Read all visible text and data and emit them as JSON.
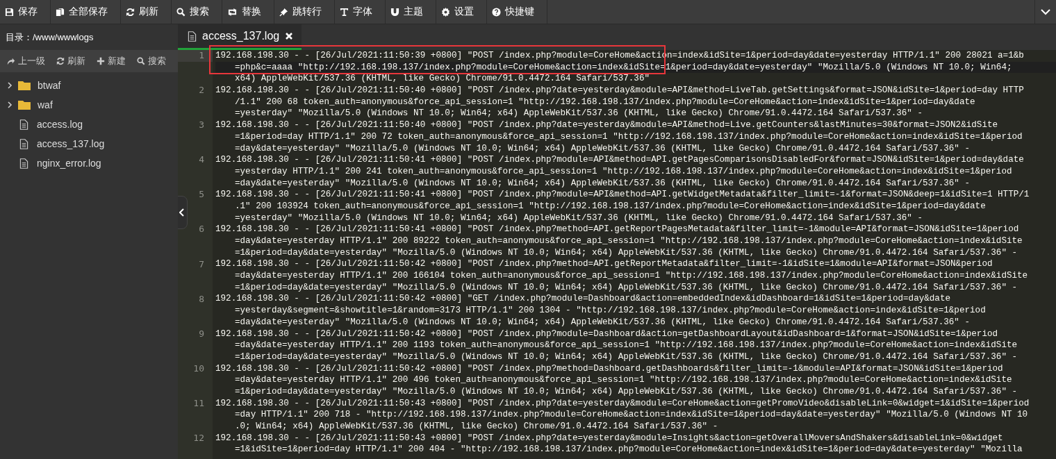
{
  "toolbar": {
    "buttons": [
      {
        "label": "保存",
        "kind": "save"
      },
      {
        "label": "全部保存",
        "kind": "saveall"
      },
      {
        "label": "刷新",
        "kind": "refresh"
      },
      {
        "label": "搜索",
        "kind": "search"
      },
      {
        "label": "替换",
        "kind": "replace"
      },
      {
        "label": "跳转行",
        "kind": "goto"
      },
      {
        "label": "字体",
        "kind": "font"
      },
      {
        "label": "主题",
        "kind": "theme"
      },
      {
        "label": "设置",
        "kind": "settings"
      },
      {
        "label": "快捷键",
        "kind": "help"
      }
    ]
  },
  "sidebar": {
    "path_label": "目录：/www/wwwlogs",
    "actions": [
      {
        "label": "上一级",
        "kind": "up"
      },
      {
        "label": "刷新",
        "kind": "refresh"
      },
      {
        "label": "新建",
        "kind": "new"
      },
      {
        "label": "搜索",
        "kind": "search"
      }
    ],
    "tree": [
      {
        "name": "btwaf",
        "kind": "folder",
        "expanded": false
      },
      {
        "name": "waf",
        "kind": "folder",
        "expanded": false
      },
      {
        "name": "access.log",
        "kind": "file"
      },
      {
        "name": "access_137.log",
        "kind": "file"
      },
      {
        "name": "nginx_error.log",
        "kind": "file"
      }
    ]
  },
  "editor": {
    "tabs": [
      {
        "title": "access_137.log",
        "selected": true
      }
    ],
    "lines": [
      {
        "number": "1",
        "active": true,
        "segments": [
          "192.168.198.30 - - [26/Jul/2021:11:50:39 +0800] \"POST /index.php?module=CoreHome&action=index&idSite=1&period=day&date=yesterday HTTP/1.1\" 200 28021 a=1&b",
          "=php&c=aaaa \"http://192.168.198.137/index.php?module=CoreHome&action=index&idSite=1&period=day&date=yesterday\" \"Mozilla/5.0 (Windows NT 10.0; Win64;",
          "x64) AppleWebKit/537.36 (KHTML, like Gecko) Chrome/91.0.4472.164 Safari/537.36\""
        ]
      },
      {
        "number": "2",
        "active": false,
        "segments": [
          "192.168.198.30 - - [26/Jul/2021:11:50:40 +0800] \"POST /index.php?date=yesterday&module=API&method=LiveTab.getSettings&format=JSON&idSite=1&period=day HTTP",
          "/1.1\" 200 68 token_auth=anonymous&force_api_session=1 \"http://192.168.198.137/index.php?module=CoreHome&action=index&idSite=1&period=day&date",
          "=yesterday\" \"Mozilla/5.0 (Windows NT 10.0; Win64; x64) AppleWebKit/537.36 (KHTML, like Gecko) Chrome/91.0.4472.164 Safari/537.36\" -"
        ]
      },
      {
        "number": "3",
        "active": false,
        "segments": [
          "192.168.198.30 - - [26/Jul/2021:11:50:40 +0800] \"POST /index.php?date=yesterday&module=API&method=Live.getCounters&lastMinutes=30&format=JSON2&idSite",
          "=1&period=day HTTP/1.1\" 200 72 token_auth=anonymous&force_api_session=1 \"http://192.168.198.137/index.php?module=CoreHome&action=index&idSite=1&period",
          "=day&date=yesterday\" \"Mozilla/5.0 (Windows NT 10.0; Win64; x64) AppleWebKit/537.36 (KHTML, like Gecko) Chrome/91.0.4472.164 Safari/537.36\" -"
        ]
      },
      {
        "number": "4",
        "active": false,
        "segments": [
          "192.168.198.30 - - [26/Jul/2021:11:50:41 +0800] \"POST /index.php?module=API&method=API.getPagesComparisonsDisabledFor&format=JSON&idSite=1&period=day&date",
          "=yesterday HTTP/1.1\" 200 241 token_auth=anonymous&force_api_session=1 \"http://192.168.198.137/index.php?module=CoreHome&action=index&idSite=1&period",
          "=day&date=yesterday\" \"Mozilla/5.0 (Windows NT 10.0; Win64; x64) AppleWebKit/537.36 (KHTML, like Gecko) Chrome/91.0.4472.164 Safari/537.36\" -"
        ]
      },
      {
        "number": "5",
        "active": false,
        "segments": [
          "192.168.198.30 - - [26/Jul/2021:11:50:41 +0800] \"POST /index.php?module=API&method=API.getWidgetMetadata&filter_limit=-1&format=JSON&deep=1&idSite=1 HTTP/1",
          ".1\" 200 103924 token_auth=anonymous&force_api_session=1 \"http://192.168.198.137/index.php?module=CoreHome&action=index&idSite=1&period=day&date",
          "=yesterday\" \"Mozilla/5.0 (Windows NT 10.0; Win64; x64) AppleWebKit/537.36 (KHTML, like Gecko) Chrome/91.0.4472.164 Safari/537.36\" -"
        ]
      },
      {
        "number": "6",
        "active": false,
        "segments": [
          "192.168.198.30 - - [26/Jul/2021:11:50:41 +0800] \"POST /index.php?method=API.getReportPagesMetadata&filter_limit=-1&module=API&format=JSON&idSite=1&period",
          "=day&date=yesterday HTTP/1.1\" 200 89222 token_auth=anonymous&force_api_session=1 \"http://192.168.198.137/index.php?module=CoreHome&action=index&idSite",
          "=1&period=day&date=yesterday\" \"Mozilla/5.0 (Windows NT 10.0; Win64; x64) AppleWebKit/537.36 (KHTML, like Gecko) Chrome/91.0.4472.164 Safari/537.36\" -"
        ]
      },
      {
        "number": "7",
        "active": false,
        "segments": [
          "192.168.198.30 - - [26/Jul/2021:11:50:42 +0800] \"POST /index.php?method=API.getReportMetadata&filter_limit=-1&idSite=1&module=API&format=JSON&period",
          "=day&date=yesterday HTTP/1.1\" 200 166104 token_auth=anonymous&force_api_session=1 \"http://192.168.198.137/index.php?module=CoreHome&action=index&idSite",
          "=1&period=day&date=yesterday\" \"Mozilla/5.0 (Windows NT 10.0; Win64; x64) AppleWebKit/537.36 (KHTML, like Gecko) Chrome/91.0.4472.164 Safari/537.36\" -"
        ]
      },
      {
        "number": "8",
        "active": false,
        "segments": [
          "192.168.198.30 - - [26/Jul/2021:11:50:42 +0800] \"GET /index.php?module=Dashboard&action=embeddedIndex&idDashboard=1&idSite=1&period=day&date",
          "=yesterday&segment=&showtitle=1&random=3173 HTTP/1.1\" 200 1304 - \"http://192.168.198.137/index.php?module=CoreHome&action=index&idSite=1&period",
          "=day&date=yesterday\" \"Mozilla/5.0 (Windows NT 10.0; Win64; x64) AppleWebKit/537.36 (KHTML, like Gecko) Chrome/91.0.4472.164 Safari/537.36\" -"
        ]
      },
      {
        "number": "9",
        "active": false,
        "segments": [
          "192.168.198.30 - - [26/Jul/2021:11:50:42 +0800] \"POST /index.php?module=Dashboard&action=getDashboardLayout&idDashboard=1&format=JSON&idSite=1&period",
          "=day&date=yesterday HTTP/1.1\" 200 1193 token_auth=anonymous&force_api_session=1 \"http://192.168.198.137/index.php?module=CoreHome&action=index&idSite",
          "=1&period=day&date=yesterday\" \"Mozilla/5.0 (Windows NT 10.0; Win64; x64) AppleWebKit/537.36 (KHTML, like Gecko) Chrome/91.0.4472.164 Safari/537.36\" -"
        ]
      },
      {
        "number": "10",
        "active": false,
        "segments": [
          "192.168.198.30 - - [26/Jul/2021:11:50:42 +0800] \"POST /index.php?method=Dashboard.getDashboards&filter_limit=-1&module=API&format=JSON&idSite=1&period",
          "=day&date=yesterday HTTP/1.1\" 200 496 token_auth=anonymous&force_api_session=1 \"http://192.168.198.137/index.php?module=CoreHome&action=index&idSite",
          "=1&period=day&date=yesterday\" \"Mozilla/5.0 (Windows NT 10.0; Win64; x64) AppleWebKit/537.36 (KHTML, like Gecko) Chrome/91.0.4472.164 Safari/537.36\" -"
        ]
      },
      {
        "number": "11",
        "active": false,
        "segments": [
          "192.168.198.30 - - [26/Jul/2021:11:50:43 +0800] \"POST /index.php?date=yesterday&module=CoreHome&action=getPromoVideo&disableLink=0&widget=1&idSite=1&period",
          "=day HTTP/1.1\" 200 718 - \"http://192.168.198.137/index.php?module=CoreHome&action=index&idSite=1&period=day&date=yesterday\" \"Mozilla/5.0 (Windows NT 10",
          ".0; Win64; x64) AppleWebKit/537.36 (KHTML, like Gecko) Chrome/91.0.4472.164 Safari/537.36\" -"
        ]
      },
      {
        "number": "12",
        "active": false,
        "segments": [
          "192.168.198.30 - - [26/Jul/2021:11:50:43 +0800] \"POST /index.php?date=yesterday&module=Insights&action=getOverallMoversAndShakers&disableLink=0&widget",
          "=1&idSite=1&period=day HTTP/1.1\" 200 404 - \"http://192.168.198.137/index.php?module=CoreHome&action=index&idSite=1&period=day&date=yesterday\" \"Mozilla"
        ]
      }
    ]
  }
}
